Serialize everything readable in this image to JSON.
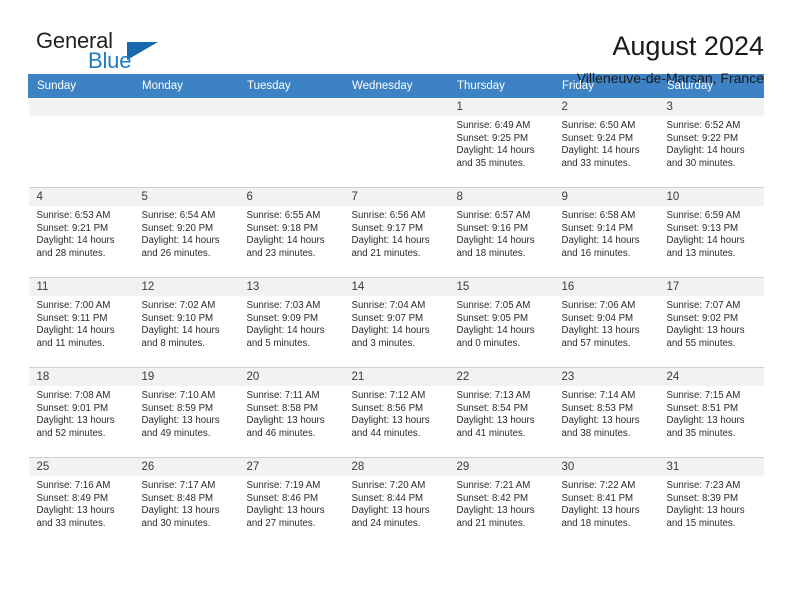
{
  "brand": {
    "name_part1": "General",
    "name_part2": "Blue",
    "triangle_icon": "triangle-icon",
    "color_dark": "#231f20",
    "color_blue": "#1c7cc4"
  },
  "header": {
    "title": "August 2024",
    "subtitle": "Villeneuve-de-Marsan, France",
    "header_bg": "#3c82c4"
  },
  "calendar": {
    "weekday_headers": [
      "Sunday",
      "Monday",
      "Tuesday",
      "Wednesday",
      "Thursday",
      "Friday",
      "Saturday"
    ],
    "labels": {
      "sunrise": "Sunrise:",
      "sunset": "Sunset:",
      "daylight": "Daylight:"
    },
    "weeks": [
      [
        {
          "day": "",
          "empty": true
        },
        {
          "day": "",
          "empty": true
        },
        {
          "day": "",
          "empty": true
        },
        {
          "day": "",
          "empty": true
        },
        {
          "day": "1",
          "sunrise": "Sunrise: 6:49 AM",
          "sunset": "Sunset: 9:25 PM",
          "daylight": "Daylight: 14 hours and 35 minutes."
        },
        {
          "day": "2",
          "sunrise": "Sunrise: 6:50 AM",
          "sunset": "Sunset: 9:24 PM",
          "daylight": "Daylight: 14 hours and 33 minutes."
        },
        {
          "day": "3",
          "sunrise": "Sunrise: 6:52 AM",
          "sunset": "Sunset: 9:22 PM",
          "daylight": "Daylight: 14 hours and 30 minutes."
        }
      ],
      [
        {
          "day": "4",
          "sunrise": "Sunrise: 6:53 AM",
          "sunset": "Sunset: 9:21 PM",
          "daylight": "Daylight: 14 hours and 28 minutes."
        },
        {
          "day": "5",
          "sunrise": "Sunrise: 6:54 AM",
          "sunset": "Sunset: 9:20 PM",
          "daylight": "Daylight: 14 hours and 26 minutes."
        },
        {
          "day": "6",
          "sunrise": "Sunrise: 6:55 AM",
          "sunset": "Sunset: 9:18 PM",
          "daylight": "Daylight: 14 hours and 23 minutes."
        },
        {
          "day": "7",
          "sunrise": "Sunrise: 6:56 AM",
          "sunset": "Sunset: 9:17 PM",
          "daylight": "Daylight: 14 hours and 21 minutes."
        },
        {
          "day": "8",
          "sunrise": "Sunrise: 6:57 AM",
          "sunset": "Sunset: 9:16 PM",
          "daylight": "Daylight: 14 hours and 18 minutes."
        },
        {
          "day": "9",
          "sunrise": "Sunrise: 6:58 AM",
          "sunset": "Sunset: 9:14 PM",
          "daylight": "Daylight: 14 hours and 16 minutes."
        },
        {
          "day": "10",
          "sunrise": "Sunrise: 6:59 AM",
          "sunset": "Sunset: 9:13 PM",
          "daylight": "Daylight: 14 hours and 13 minutes."
        }
      ],
      [
        {
          "day": "11",
          "sunrise": "Sunrise: 7:00 AM",
          "sunset": "Sunset: 9:11 PM",
          "daylight": "Daylight: 14 hours and 11 minutes."
        },
        {
          "day": "12",
          "sunrise": "Sunrise: 7:02 AM",
          "sunset": "Sunset: 9:10 PM",
          "daylight": "Daylight: 14 hours and 8 minutes."
        },
        {
          "day": "13",
          "sunrise": "Sunrise: 7:03 AM",
          "sunset": "Sunset: 9:09 PM",
          "daylight": "Daylight: 14 hours and 5 minutes."
        },
        {
          "day": "14",
          "sunrise": "Sunrise: 7:04 AM",
          "sunset": "Sunset: 9:07 PM",
          "daylight": "Daylight: 14 hours and 3 minutes."
        },
        {
          "day": "15",
          "sunrise": "Sunrise: 7:05 AM",
          "sunset": "Sunset: 9:05 PM",
          "daylight": "Daylight: 14 hours and 0 minutes."
        },
        {
          "day": "16",
          "sunrise": "Sunrise: 7:06 AM",
          "sunset": "Sunset: 9:04 PM",
          "daylight": "Daylight: 13 hours and 57 minutes."
        },
        {
          "day": "17",
          "sunrise": "Sunrise: 7:07 AM",
          "sunset": "Sunset: 9:02 PM",
          "daylight": "Daylight: 13 hours and 55 minutes."
        }
      ],
      [
        {
          "day": "18",
          "sunrise": "Sunrise: 7:08 AM",
          "sunset": "Sunset: 9:01 PM",
          "daylight": "Daylight: 13 hours and 52 minutes."
        },
        {
          "day": "19",
          "sunrise": "Sunrise: 7:10 AM",
          "sunset": "Sunset: 8:59 PM",
          "daylight": "Daylight: 13 hours and 49 minutes."
        },
        {
          "day": "20",
          "sunrise": "Sunrise: 7:11 AM",
          "sunset": "Sunset: 8:58 PM",
          "daylight": "Daylight: 13 hours and 46 minutes."
        },
        {
          "day": "21",
          "sunrise": "Sunrise: 7:12 AM",
          "sunset": "Sunset: 8:56 PM",
          "daylight": "Daylight: 13 hours and 44 minutes."
        },
        {
          "day": "22",
          "sunrise": "Sunrise: 7:13 AM",
          "sunset": "Sunset: 8:54 PM",
          "daylight": "Daylight: 13 hours and 41 minutes."
        },
        {
          "day": "23",
          "sunrise": "Sunrise: 7:14 AM",
          "sunset": "Sunset: 8:53 PM",
          "daylight": "Daylight: 13 hours and 38 minutes."
        },
        {
          "day": "24",
          "sunrise": "Sunrise: 7:15 AM",
          "sunset": "Sunset: 8:51 PM",
          "daylight": "Daylight: 13 hours and 35 minutes."
        }
      ],
      [
        {
          "day": "25",
          "sunrise": "Sunrise: 7:16 AM",
          "sunset": "Sunset: 8:49 PM",
          "daylight": "Daylight: 13 hours and 33 minutes."
        },
        {
          "day": "26",
          "sunrise": "Sunrise: 7:17 AM",
          "sunset": "Sunset: 8:48 PM",
          "daylight": "Daylight: 13 hours and 30 minutes."
        },
        {
          "day": "27",
          "sunrise": "Sunrise: 7:19 AM",
          "sunset": "Sunset: 8:46 PM",
          "daylight": "Daylight: 13 hours and 27 minutes."
        },
        {
          "day": "28",
          "sunrise": "Sunrise: 7:20 AM",
          "sunset": "Sunset: 8:44 PM",
          "daylight": "Daylight: 13 hours and 24 minutes."
        },
        {
          "day": "29",
          "sunrise": "Sunrise: 7:21 AM",
          "sunset": "Sunset: 8:42 PM",
          "daylight": "Daylight: 13 hours and 21 minutes."
        },
        {
          "day": "30",
          "sunrise": "Sunrise: 7:22 AM",
          "sunset": "Sunset: 8:41 PM",
          "daylight": "Daylight: 13 hours and 18 minutes."
        },
        {
          "day": "31",
          "sunrise": "Sunrise: 7:23 AM",
          "sunset": "Sunset: 8:39 PM",
          "daylight": "Daylight: 13 hours and 15 minutes."
        }
      ]
    ]
  }
}
